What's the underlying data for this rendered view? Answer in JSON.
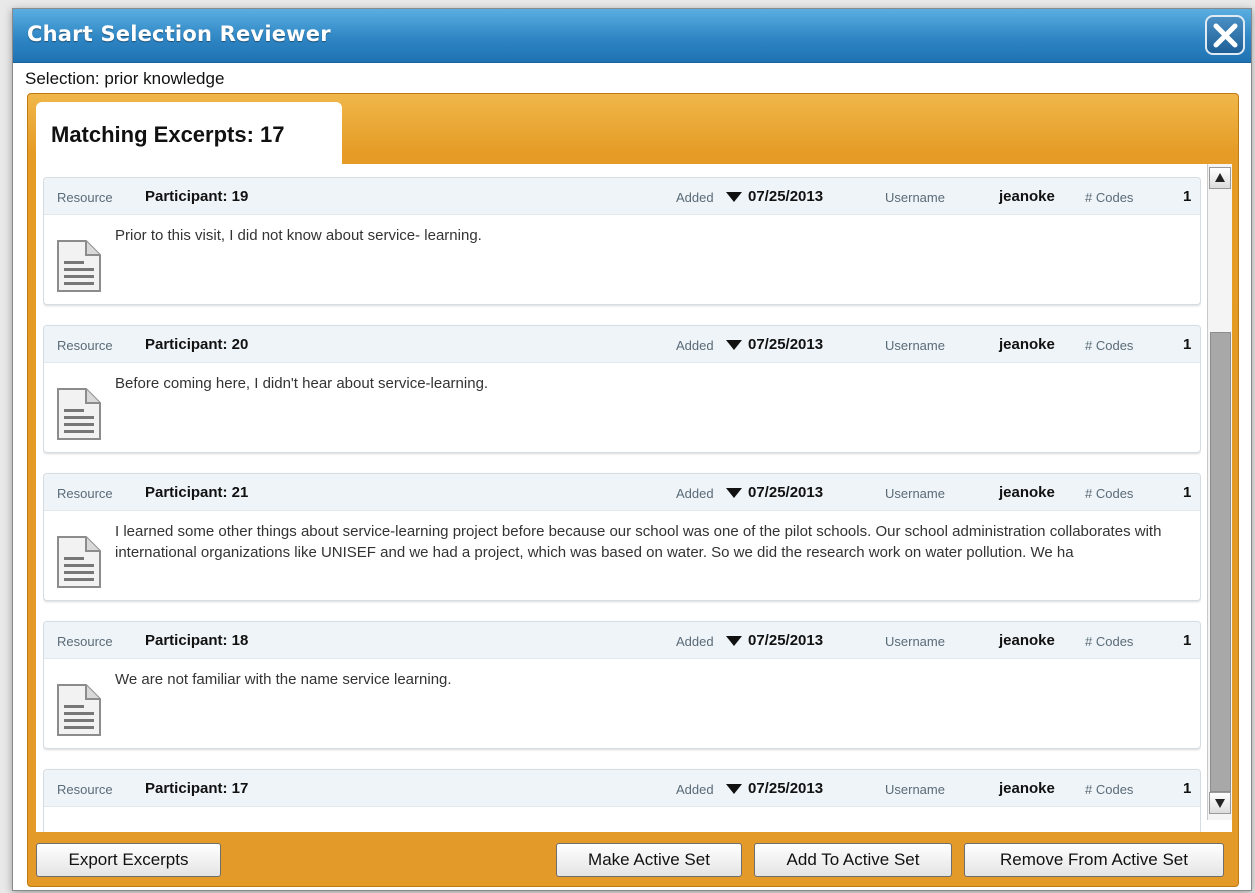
{
  "window": {
    "title": "Chart Selection Reviewer",
    "close_icon": "close-x-icon"
  },
  "selection": {
    "text": "Selection: prior knowledge"
  },
  "tab": {
    "label": "Matching Excerpts: 17"
  },
  "labels": {
    "resource": "Resource",
    "added": "Added",
    "username": "Username",
    "codes": "# Codes"
  },
  "excerpts": [
    {
      "resource": "Participant: 19",
      "added": "07/25/2013",
      "username": "jeanoke",
      "codes": "1",
      "text": "Prior to this visit, I did not know about service- learning."
    },
    {
      "resource": "Participant: 20",
      "added": "07/25/2013",
      "username": "jeanoke",
      "codes": "1",
      "text": "Before coming here, I didn't hear about service-learning."
    },
    {
      "resource": "Participant: 21",
      "added": "07/25/2013",
      "username": "jeanoke",
      "codes": "1",
      "text": "I learned some other things about service-learning project before because our school was one of the pilot schools. Our school administration collaborates with international organizations like UNISEF and we had a project, which was based on water. So we did the research work on water pollution. We ha"
    },
    {
      "resource": "Participant: 18",
      "added": "07/25/2013",
      "username": "jeanoke",
      "codes": "1",
      "text": "We are not familiar with the name service learning."
    },
    {
      "resource": "Participant: 17",
      "added": "07/25/2013",
      "username": "jeanoke",
      "codes": "1",
      "text": ""
    }
  ],
  "buttons": {
    "export": "Export Excerpts",
    "make_active": "Make Active Set",
    "add_active": "Add To Active Set",
    "remove_active": "Remove From Active Set"
  },
  "colors": {
    "titlebar": "#2f86c4",
    "panel": "#e59b25",
    "header_bg": "#eef4f7"
  },
  "icons": {
    "document": "document-icon",
    "sort": "sort-down-icon",
    "scroll_up": "scroll-up-arrow-icon",
    "scroll_down": "scroll-down-arrow-icon"
  }
}
